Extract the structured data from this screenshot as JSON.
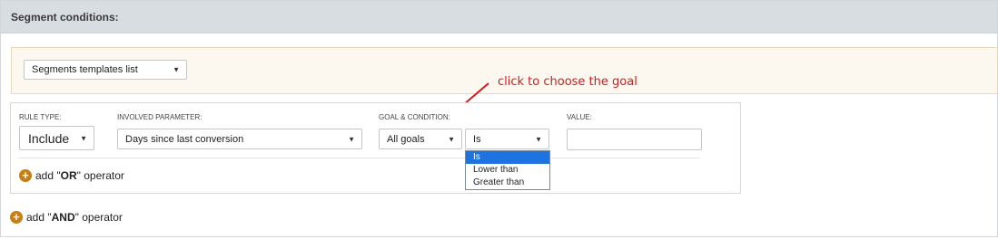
{
  "header": {
    "title": "Segment conditions:"
  },
  "templates": {
    "select_value": "Segments templates list"
  },
  "annotation": {
    "text": "click to choose the goal",
    "color": "#cc1e1e"
  },
  "rule": {
    "labels": {
      "rule_type": "RULE TYPE:",
      "involved_parameter": "INVOLVED PARAMETER:",
      "goal_condition": "GOAL & CONDITION:",
      "value": "VALUE:"
    },
    "rule_type_value": "Include",
    "parameter_value": "Days since last conversion",
    "goal_value": "All goals",
    "condition_value": "Is",
    "value_input": "",
    "add_or": {
      "prefix": "add \"",
      "keyword": "OR",
      "suffix": "\" operator"
    }
  },
  "condition_dropdown": {
    "options": [
      "Is",
      "Lower than",
      "Greater than"
    ],
    "selected": "Is"
  },
  "add_and": {
    "prefix": "add \"",
    "keyword": "AND",
    "suffix": "\" operator"
  },
  "colors": {
    "accent_orange": "#c97d12",
    "highlight_blue": "#1e73e0",
    "header_bg": "#d8dde2"
  }
}
